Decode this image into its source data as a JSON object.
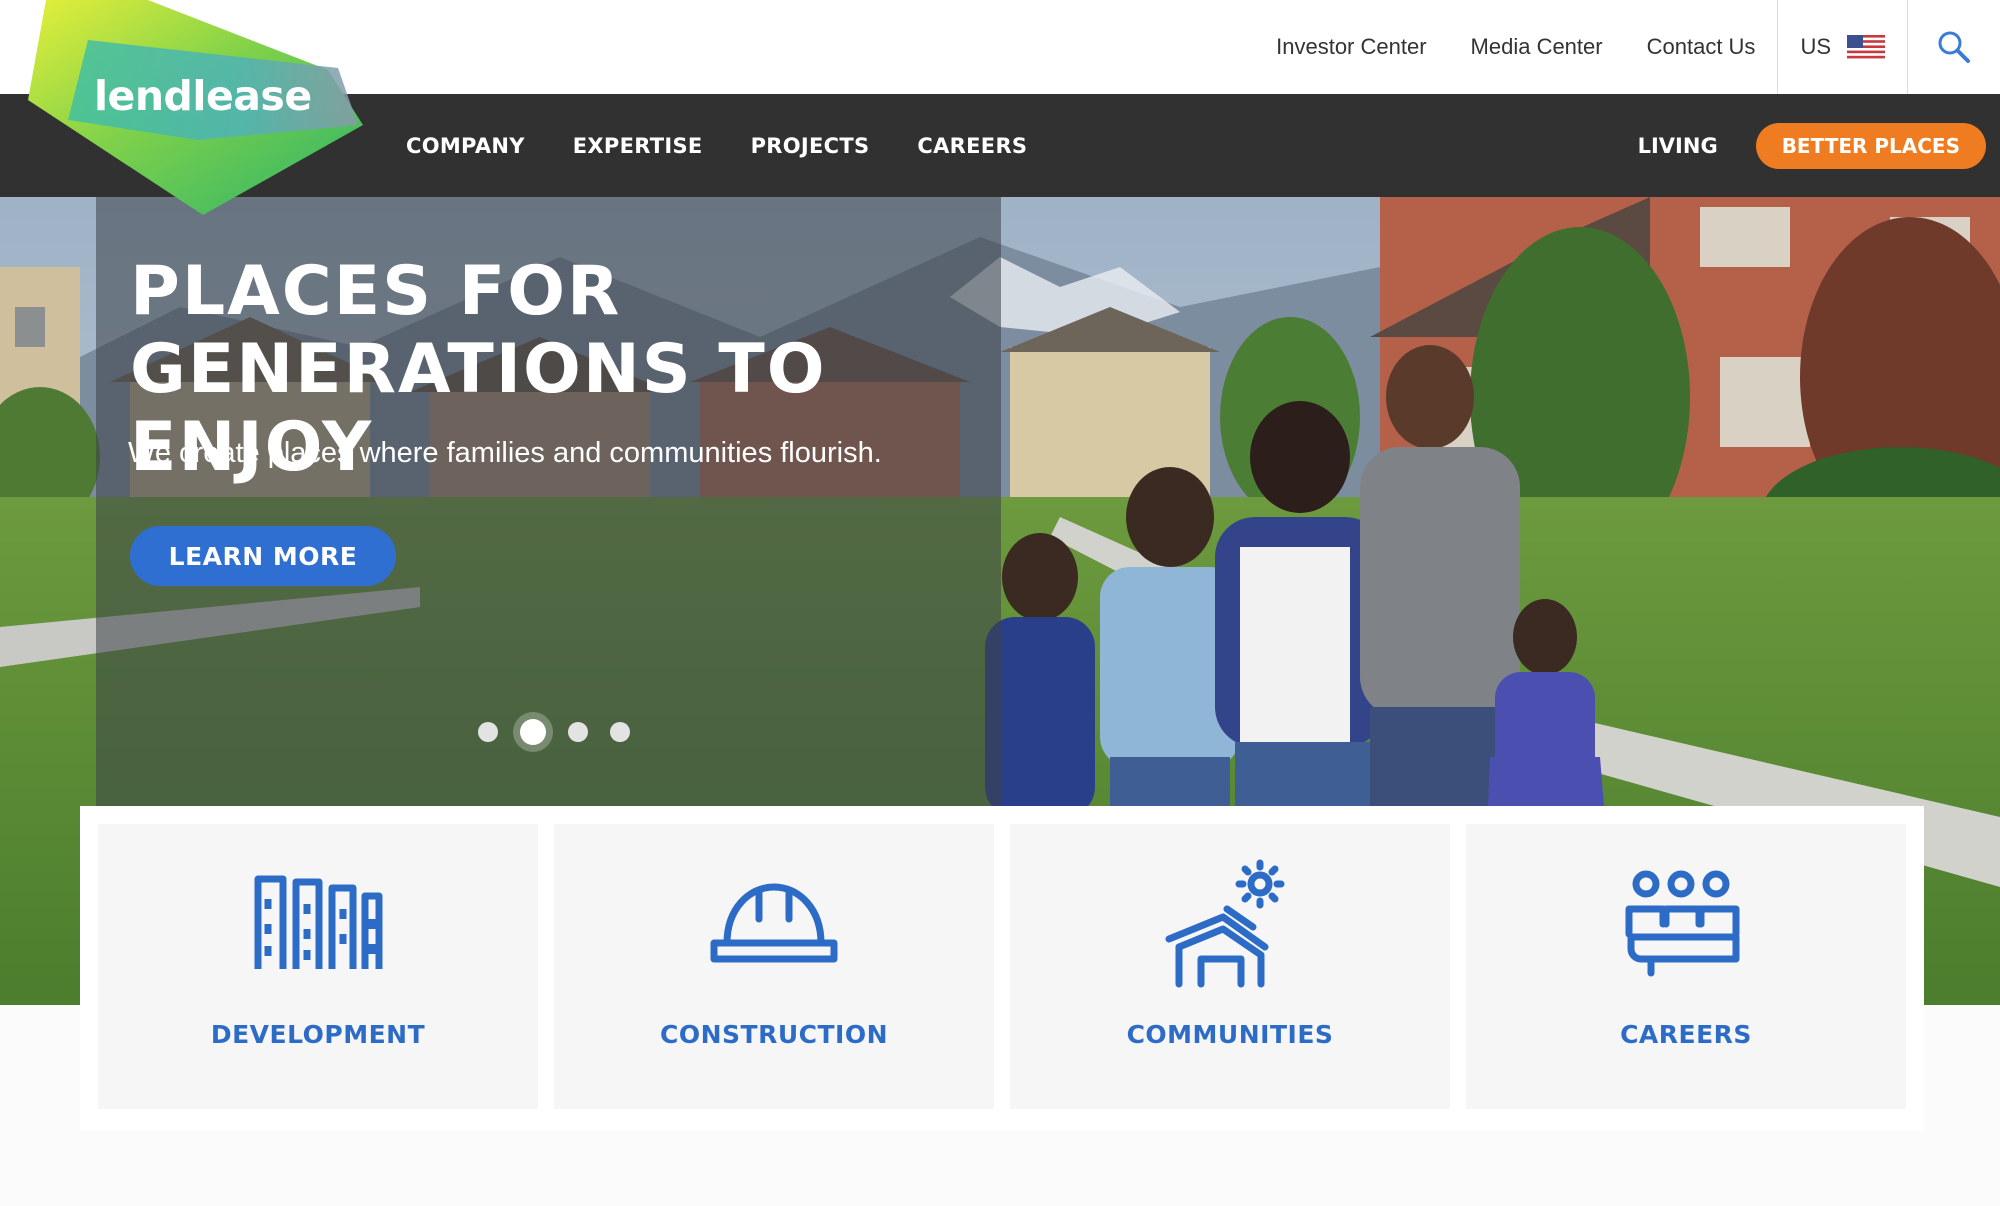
{
  "brand": {
    "logo_text": "lendlease"
  },
  "utility_nav": {
    "links": [
      "Investor Center",
      "Media Center",
      "Contact Us"
    ],
    "region": "US",
    "icons": {
      "flag": "us-flag-icon",
      "search": "search-icon"
    }
  },
  "main_nav": {
    "items": [
      "COMPANY",
      "EXPERTISE",
      "PROJECTS",
      "CAREERS"
    ],
    "living": "LIVING",
    "cta": "BETTER PLACES"
  },
  "hero": {
    "title": "PLACES FOR GENERATIONS TO ENJOY",
    "subtitle": "We create places where families and communities flourish.",
    "button": "LEARN MORE",
    "slides": 4,
    "active_slide": 2
  },
  "services": [
    {
      "label": "DEVELOPMENT",
      "icon": "buildings-icon"
    },
    {
      "label": "CONSTRUCTION",
      "icon": "hard-hat-icon"
    },
    {
      "label": "COMMUNITIES",
      "icon": "house-sun-icon"
    },
    {
      "label": "CAREERS",
      "icon": "people-group-icon"
    }
  ],
  "colors": {
    "nav_bg": "#313131",
    "accent_orange": "#f07c21",
    "primary_blue": "#2e6fd1",
    "icon_blue": "#2d6cc6",
    "logo_green": "#4cc56a",
    "logo_lime": "#d7e84a"
  }
}
